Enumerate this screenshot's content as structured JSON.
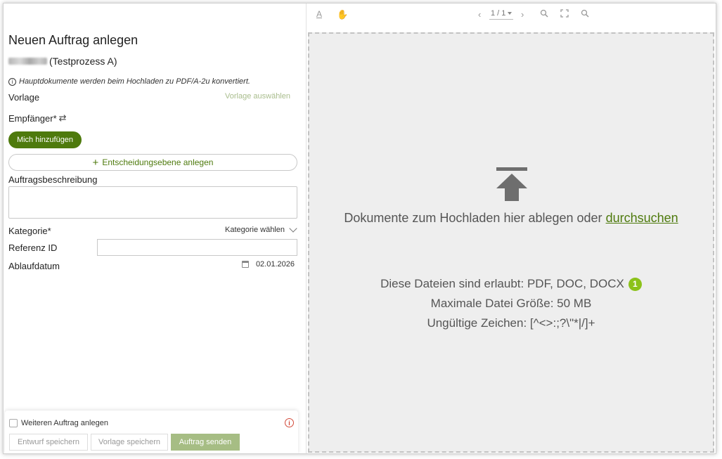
{
  "form": {
    "title": "Neuen Auftrag anlegen",
    "process": "(Testprozess A)",
    "info": "Hauptdokumente werden beim Hochladen zu PDF/A-2u konvertiert.",
    "vorlage_label": "Vorlage",
    "vorlage_link": "Vorlage auswählen",
    "recipient_label": "Empfänger*",
    "add_me_button": "Mich hinzufügen",
    "add_level_button": "Entscheidungsebene anlegen",
    "description_label": "Auftragsbeschreibung",
    "description_value": "",
    "category_label": "Kategorie*",
    "category_select": "Kategorie wählen",
    "reference_label": "Referenz ID",
    "reference_value": "",
    "expiry_label": "Ablaufdatum",
    "expiry_value": "02.01.2026"
  },
  "footer": {
    "another_label": "Weiteren Auftrag anlegen",
    "another_checked": false,
    "save_draft": "Entwurf speichern",
    "save_template": "Vorlage speichern",
    "send": "Auftrag senden"
  },
  "viewer": {
    "page_indicator": "1 / 1",
    "drop_text": "Dokumente zum Hochladen hier ablegen oder",
    "browse_link": "durchsuchen",
    "allowed_files": "Diese Dateien sind erlaubt: PDF, DOC, DOCX",
    "allowed_badge": "1",
    "max_size": "Maximale Datei Größe: 50 MB",
    "invalid_chars": "Ungültige Zeichen: [^<>:;?\\\"*|/]+"
  },
  "icons": {
    "info": "info-icon",
    "sync": "sync-icon",
    "plus": "plus-icon",
    "chevron": "chevron-down-icon",
    "calendar": "calendar-icon",
    "warning": "warning-icon",
    "text_select": "text-select-icon",
    "hand": "hand-icon",
    "prev": "prev-page-icon",
    "next": "next-page-icon",
    "zoom_out": "zoom-out-icon",
    "fullscreen": "fullscreen-icon",
    "zoom_in": "zoom-in-icon",
    "upload": "upload-icon"
  },
  "colors": {
    "accent": "#4e7a0d",
    "accent_light": "#a6bd84",
    "badge": "#8cc21a",
    "warning": "#d24a3a"
  }
}
